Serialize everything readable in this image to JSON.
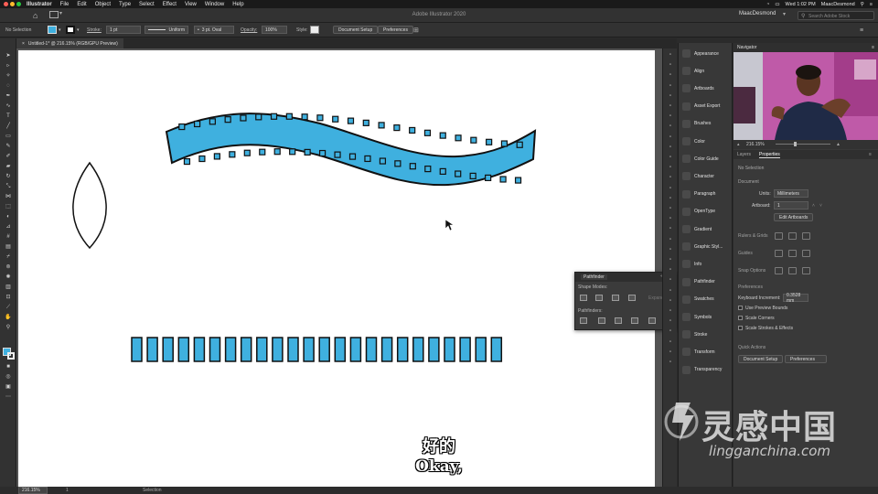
{
  "menubar": {
    "app_name": "Illustrator",
    "items": [
      "File",
      "Edit",
      "Object",
      "Type",
      "Select",
      "Effect",
      "View",
      "Window",
      "Help"
    ],
    "clock": "Wed 1:02 PM",
    "user": "MaacDesmond"
  },
  "appbar": {
    "title": "Adobe Illustrator 2020",
    "workspace_user": "MaacDesmond",
    "search_placeholder": "Search Adobe Stock"
  },
  "control_bar": {
    "selection_label": "No Selection",
    "stroke_label": "Stroke:",
    "stroke_weight": "1 pt",
    "profile_label": "Uniform",
    "brush_label": "3 pt. Oval",
    "opacity_label": "Opacity:",
    "opacity_value": "100%",
    "style_label": "Style:",
    "document_setup_button": "Document Setup",
    "preferences_button": "Preferences",
    "fill_color": "#3fb0df"
  },
  "document_tab": {
    "title": "Untitled-1* @ 216.15% (RGB/GPU Preview)"
  },
  "status_bar": {
    "zoom": "216.15%",
    "page": "1",
    "tool": "Selection"
  },
  "panel_list": [
    {
      "label": "Appearance",
      "icon": "appearance-icon"
    },
    {
      "label": "Align",
      "icon": "align-icon"
    },
    {
      "label": "Artboards",
      "icon": "artboards-icon"
    },
    {
      "label": "Asset Export",
      "icon": "asset-export-icon"
    },
    {
      "label": "Brushes",
      "icon": "brushes-icon"
    },
    {
      "label": "Color",
      "icon": "color-icon"
    },
    {
      "label": "Color Guide",
      "icon": "color-guide-icon"
    },
    {
      "label": "Character",
      "icon": "character-icon"
    },
    {
      "label": "Paragraph",
      "icon": "paragraph-icon"
    },
    {
      "label": "OpenType",
      "icon": "opentype-icon"
    },
    {
      "label": "Gradient",
      "icon": "gradient-icon"
    },
    {
      "label": "Graphic Styl...",
      "icon": "graphic-styles-icon"
    },
    {
      "label": "Info",
      "icon": "info-icon"
    },
    {
      "label": "Pathfinder",
      "icon": "pathfinder-icon"
    },
    {
      "label": "Swatches",
      "icon": "swatches-icon"
    },
    {
      "label": "Symbols",
      "icon": "symbols-icon"
    },
    {
      "label": "Stroke",
      "icon": "stroke-icon"
    },
    {
      "label": "Transform",
      "icon": "transform-icon"
    },
    {
      "label": "Transparency",
      "icon": "transparency-icon"
    }
  ],
  "navigator": {
    "title": "Navigator",
    "zoom": "216.15%"
  },
  "properties": {
    "tabs": [
      "Layers",
      "Properties"
    ],
    "active_tab": "Properties",
    "selection": "No Selection",
    "document_heading": "Document",
    "units_label": "Units:",
    "units_value": "Millimeters",
    "artboard_label": "Artboard:",
    "artboard_value": "1",
    "edit_artboards_button": "Edit Artboards",
    "rulers_grids": "Rulers & Grids",
    "guides": "Guides",
    "snap_options": "Snap Options",
    "preferences_heading": "Preferences",
    "keyboard_increment_label": "Keyboard Increment:",
    "keyboard_increment_value": "0.3528 mm",
    "use_preview_bounds": "Use Preview Bounds",
    "scale_corners": "Scale Corners",
    "scale_strokes": "Scale Strokes & Effects",
    "quick_actions_heading": "Quick Actions",
    "document_setup_button": "Document Setup",
    "preferences_button": "Preferences"
  },
  "pathfinder_panel": {
    "title": "Pathfinder",
    "shape_modes_label": "Shape Modes:",
    "expand_button": "Expand",
    "pathfinders_label": "Pathfinders:"
  },
  "artwork": {
    "fill_color": "#3fb0df",
    "stroke_color": "#111111",
    "bar_count": 24
  },
  "subtitles": {
    "chinese": "好的",
    "english": "Okay,"
  },
  "watermark": {
    "cn": "灵感中国",
    "url": "lingganchina.com"
  }
}
